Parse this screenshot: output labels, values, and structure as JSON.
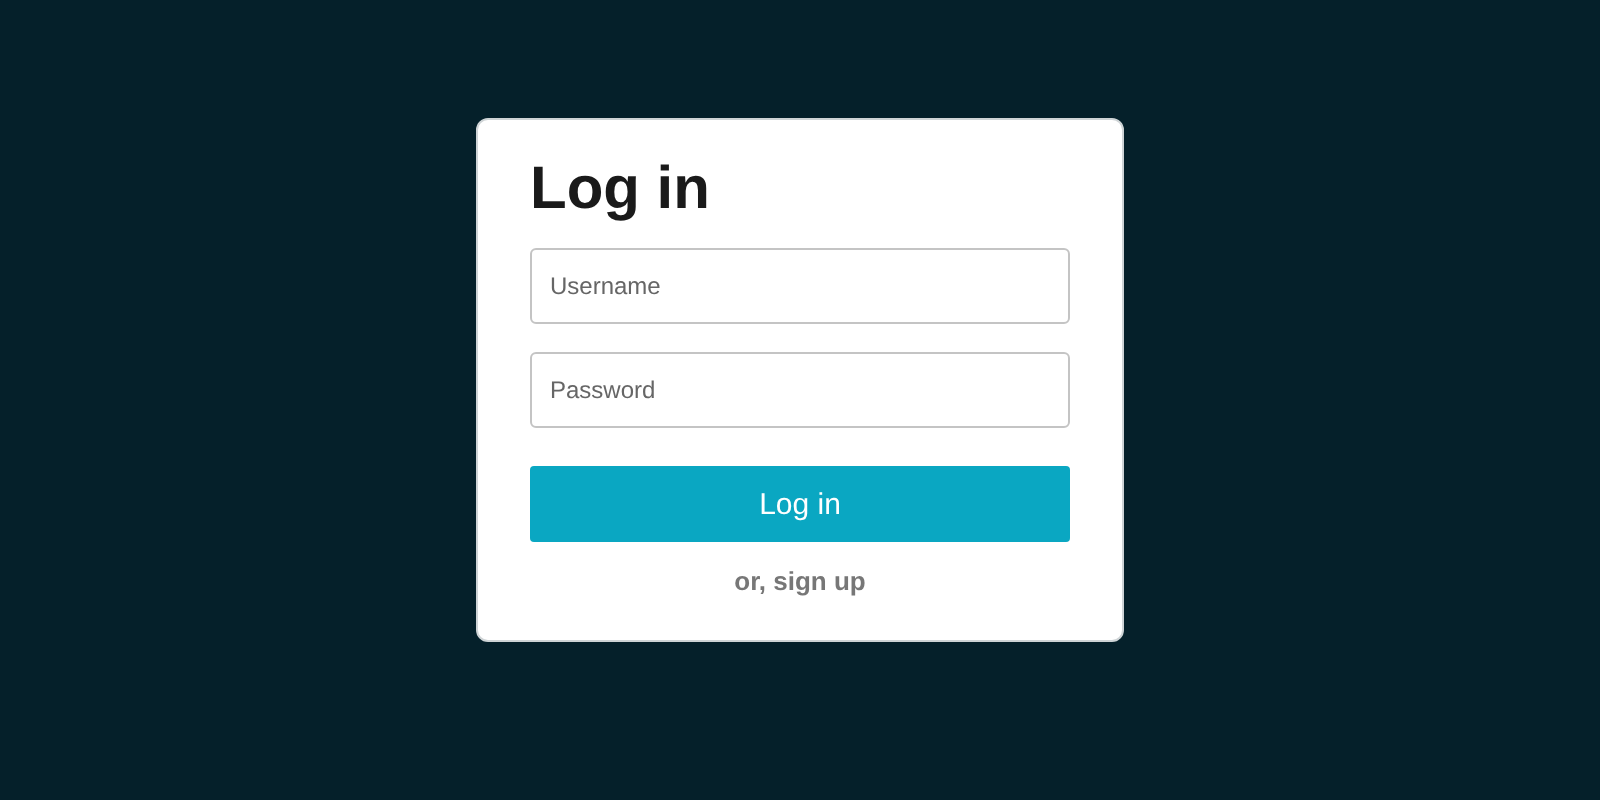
{
  "form": {
    "title": "Log in",
    "fields": [
      {
        "placeholder": "Username"
      },
      {
        "placeholder": "Password"
      }
    ],
    "submit": "Log in",
    "alt_link": "or, sign up"
  }
}
